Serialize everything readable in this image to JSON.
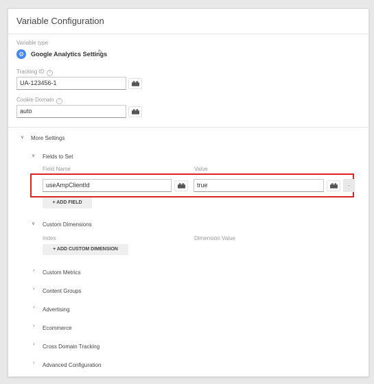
{
  "header": {
    "title": "Variable Configuration"
  },
  "variable_type": {
    "label": "Variable type",
    "name": "Google Analytics Settings"
  },
  "tracking_id": {
    "label": "Tracking ID",
    "value": "UA-123456-1"
  },
  "cookie_domain": {
    "label": "Cookie Domain",
    "value": "auto"
  },
  "help_glyph": "?",
  "more_settings": {
    "label": "More Settings"
  },
  "fields_to_set": {
    "label": "Fields to Set",
    "col_field_name": "Field Name",
    "col_value": "Value",
    "row": {
      "field_name": "useAmpClientId",
      "value": "true",
      "remove": "-"
    },
    "add_button": "+ ADD FIELD"
  },
  "custom_dimensions": {
    "label": "Custom Dimensions",
    "col_index": "Index",
    "col_value": "Dimension Value",
    "add_button": "+ ADD CUSTOM DIMENSION"
  },
  "collapsed_sections": [
    "Custom Metrics",
    "Content Groups",
    "Advertising",
    "Ecommerce",
    "Cross Domain Tracking",
    "Advanced Configuration"
  ],
  "icons": {
    "gear": "gear-icon",
    "pencil": "pencil-icon",
    "brick": "variable-brick-icon",
    "chevron": "chevron-icon"
  },
  "colors": {
    "accent": "#4285f4",
    "highlight": "#dd2222"
  }
}
